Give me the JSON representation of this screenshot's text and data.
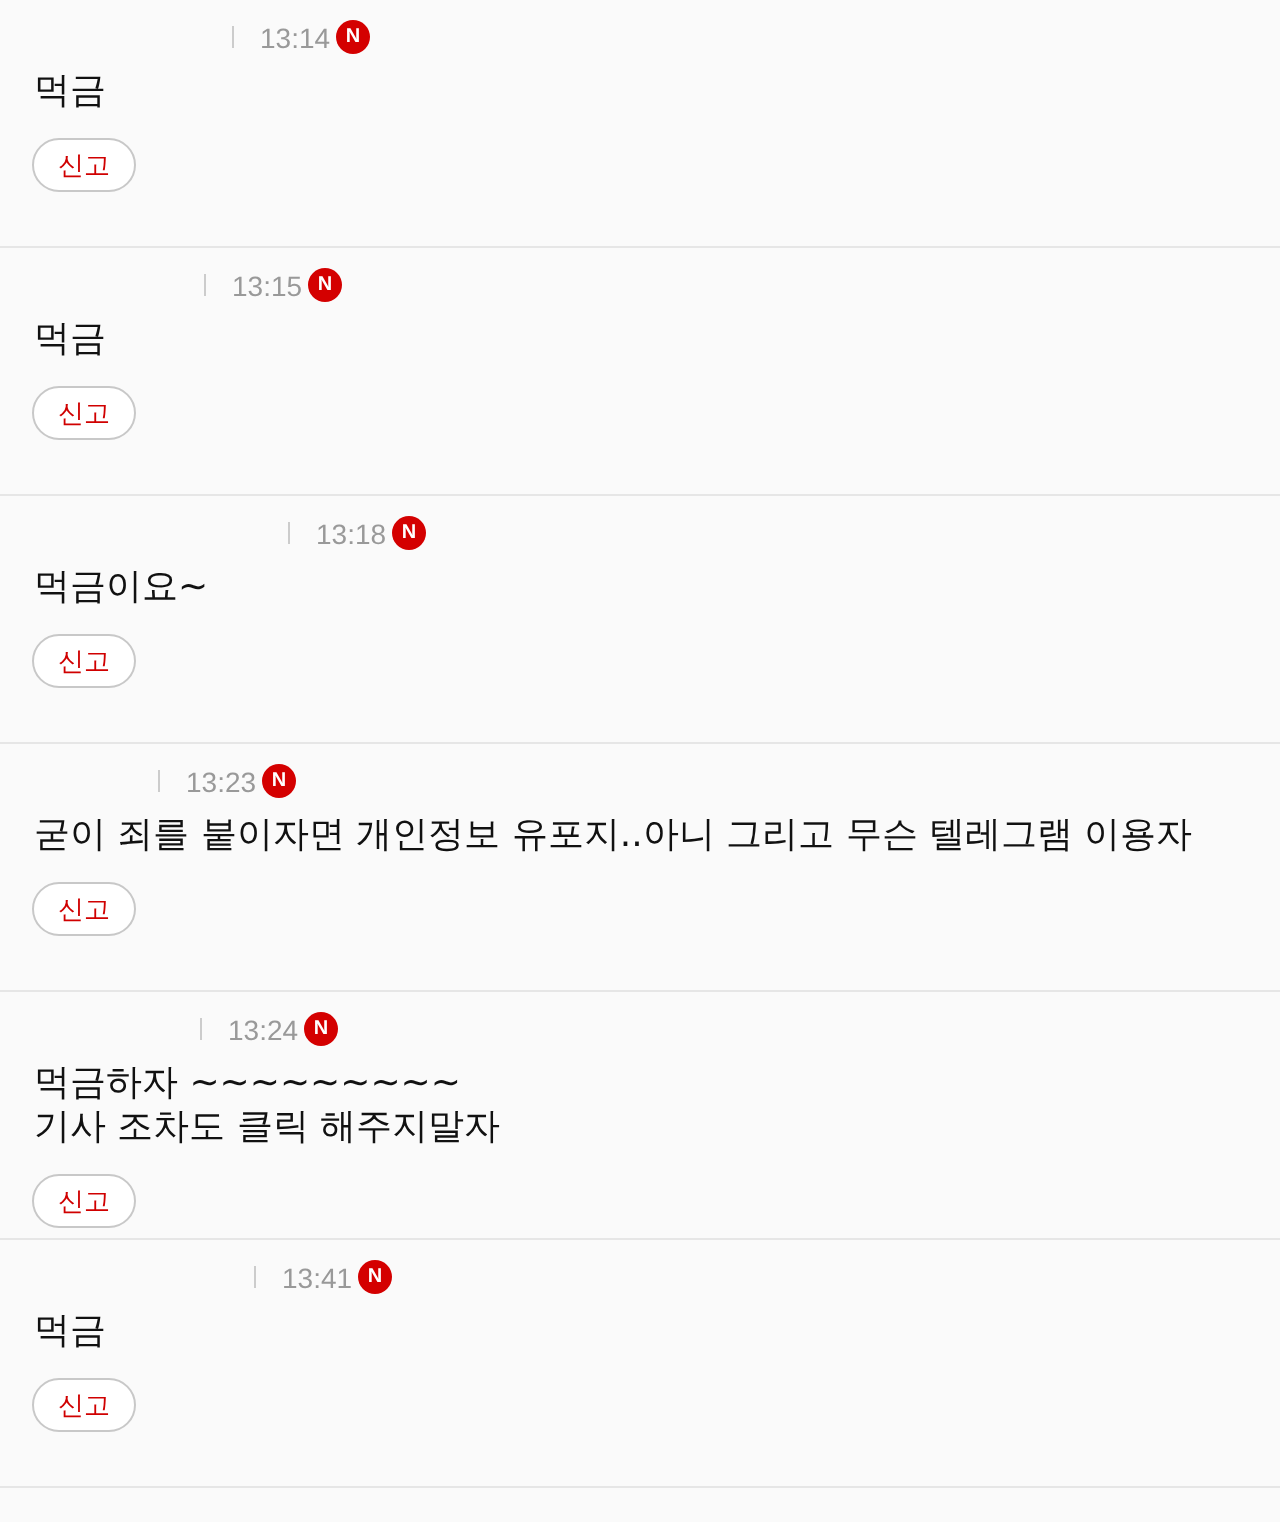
{
  "comments": [
    {
      "time": "13:14",
      "badge": "N",
      "text": [
        "먹금"
      ],
      "report": "신고"
    },
    {
      "time": "13:15",
      "badge": "N",
      "text": [
        "먹금"
      ],
      "report": "신고"
    },
    {
      "time": "13:18",
      "badge": "N",
      "text": [
        "먹금이요~"
      ],
      "report": "신고"
    },
    {
      "time": "13:23",
      "badge": "N",
      "text": [
        "굳이 죄를 붙이자면 개인정보 유포지..아니 그리고 무슨 텔레그램 이용자"
      ],
      "report": "신고"
    },
    {
      "time": "13:24",
      "badge": "N",
      "text": [
        "먹금하자 ~~~~~~~~~",
        "기사 조차도 클릭 해주지말자"
      ],
      "report": "신고"
    },
    {
      "time": "13:41",
      "badge": "N",
      "text": [
        "먹금"
      ],
      "report": "신고"
    }
  ]
}
